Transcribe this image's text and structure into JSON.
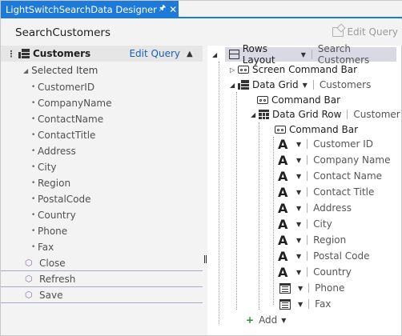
{
  "tab": {
    "title": "LightSwitchSearchData Designer",
    "pin_icon": "pin-icon",
    "close_icon": "close-icon"
  },
  "header": {
    "screen_name": "SearchCustomers",
    "edit_query": "Edit Query"
  },
  "left": {
    "query": {
      "name": "Customers",
      "edit_query": "Edit Query"
    },
    "selected_item": "Selected Item",
    "properties": [
      "CustomerID",
      "CompanyName",
      "ContactName",
      "ContactTitle",
      "Address",
      "City",
      "Region",
      "PostalCode",
      "Country",
      "Phone",
      "Fax"
    ],
    "commands": [
      "Close",
      "Refresh",
      "Save"
    ]
  },
  "tree": {
    "root": {
      "label": "Rows Layout",
      "sub": "Search Customers"
    },
    "screen_command_bar": "Screen Command Bar",
    "data_grid": {
      "label": "Data Grid",
      "sub": "Customers"
    },
    "grid_command_bar": "Command Bar",
    "data_grid_row": {
      "label": "Data Grid Row",
      "sub": "Customer"
    },
    "row_command_bar": "Command Bar",
    "fields": [
      {
        "label": "Customer ID",
        "control": "text-icon",
        "glyph": "A"
      },
      {
        "label": "Company Name",
        "control": "text-icon",
        "glyph": "A"
      },
      {
        "label": "Contact Name",
        "control": "text-icon",
        "glyph": "A"
      },
      {
        "label": "Contact Title",
        "control": "text-icon",
        "glyph": "A"
      },
      {
        "label": "Address",
        "control": "text-icon",
        "glyph": "A"
      },
      {
        "label": "City",
        "control": "text-icon",
        "glyph": "A"
      },
      {
        "label": "Region",
        "control": "text-icon",
        "glyph": "A"
      },
      {
        "label": "Postal Code",
        "control": "text-icon",
        "glyph": "A"
      },
      {
        "label": "Country",
        "control": "text-icon",
        "glyph": "A"
      },
      {
        "label": "Phone",
        "control": "phone-icon",
        "glyph": ""
      },
      {
        "label": "Fax",
        "control": "phone-icon",
        "glyph": ""
      }
    ],
    "add": "Add"
  },
  "colors": {
    "accent": "#1d7ad9",
    "link": "#1a5fb4",
    "add_plus": "#2e8b2e",
    "command_icon": "#8a6db5"
  }
}
